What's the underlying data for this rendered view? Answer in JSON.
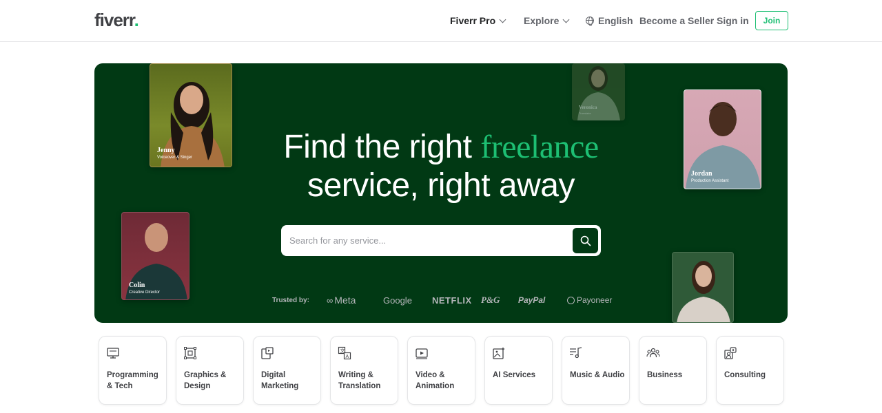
{
  "header": {
    "logo_text": "fiverr",
    "logo_dot": ".",
    "nav_pro": "Fiverr Pro",
    "nav_explore": "Explore",
    "nav_language": "English",
    "nav_become_seller": "Become a Seller",
    "nav_sign_in": "Sign in",
    "join_label": "Join"
  },
  "hero": {
    "title_line1_a": "Find the right ",
    "title_line1_accent": "freelance",
    "title_line2": "service, right away",
    "search_placeholder": "Search for any service...",
    "trusted_label": "Trusted by:",
    "brands": [
      "Meta",
      "Google",
      "NETFLIX",
      "P&G",
      "PayPal",
      "Payoneer"
    ],
    "cards": [
      {
        "name": "Jenny",
        "role": "Voiceover & Singer"
      },
      {
        "name": "Colin",
        "role": "Creative Director"
      },
      {
        "name": "Veronica",
        "role": "Translator"
      },
      {
        "name": "Jordan",
        "role": "Production Assistant"
      }
    ]
  },
  "categories": [
    {
      "label": "Programming & Tech",
      "icon": "monitor-code-icon"
    },
    {
      "label": "Graphics & Design",
      "icon": "vector-design-icon"
    },
    {
      "label": "Digital Marketing",
      "icon": "digital-marketing-icon"
    },
    {
      "label": "Writing & Translation",
      "icon": "translation-icon"
    },
    {
      "label": "Video & Animation",
      "icon": "video-play-icon"
    },
    {
      "label": "AI Services",
      "icon": "ai-image-icon"
    },
    {
      "label": "Music & Audio",
      "icon": "music-note-icon"
    },
    {
      "label": "Business",
      "icon": "business-people-icon"
    },
    {
      "label": "Consulting",
      "icon": "consulting-icon"
    }
  ],
  "colors": {
    "brand_green": "#1dbf73",
    "hero_bg": "#013914"
  }
}
